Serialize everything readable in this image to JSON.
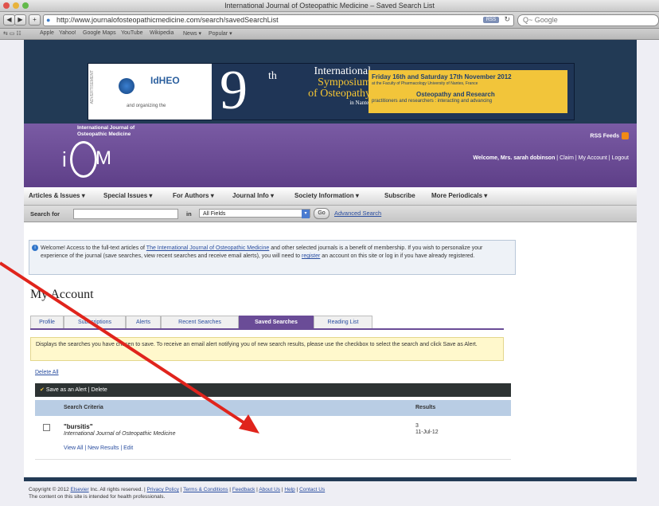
{
  "browser": {
    "window_title": "International Journal of Osteopathic Medicine – Saved Search List",
    "url": "http://www.journalofosteopathicmedicine.com/search/savedSearchList",
    "search_placeholder": "Q~ Google",
    "rss_label": "RSS",
    "bookmarks": [
      "Apple",
      "Yahoo!",
      "Google Maps",
      "YouTube",
      "Wikipedia",
      "News ▾",
      "Popular ▾"
    ]
  },
  "banner": {
    "advert_label": "ADVERTISEMENT",
    "brand": "IdHEO",
    "organizer": "and organizing the",
    "number": "9",
    "ordinal": "th",
    "symposium": [
      "International",
      "Symposium",
      "of Osteopathy",
      "in Nantes"
    ],
    "dates": "Friday 16th and Saturday 17th November 2012",
    "venue": "at the Faculty of Pharmacology University of Nantes, France",
    "theme": "Osteopathy and Research",
    "tagline": "practitioners and researchers : interacting and advancing"
  },
  "header": {
    "journal_name_l1": "International Journal of",
    "journal_name_l2": "Osteopathic Medicine",
    "logo_letters": {
      "i": "i",
      "m": "M"
    },
    "rss_feeds": "RSS Feeds",
    "welcome": "Welcome, Mrs. sarah dobinson",
    "claim": "Claim",
    "my_account": "My Account",
    "logout": "Logout"
  },
  "nav": [
    "Articles & Issues ▾",
    "Special Issues ▾",
    "For Authors ▾",
    "Journal Info ▾",
    "Society Information ▾",
    "Subscribe",
    "More Periodicals ▾"
  ],
  "search": {
    "label": "Search for",
    "in_label": "in",
    "field": "All Fields",
    "go": "Go",
    "advanced": "Advanced Search"
  },
  "notice": {
    "part1": "Welcome! Access to the full-text articles of ",
    "journal_link": "The International Journal of Osteopathic Medicine",
    "part2": " and other selected journals is a benefit of membership. If you wish to personalize your experience of the journal (save searches, view recent searches and receive email alerts), you will need to ",
    "register": "register",
    "part3": " an account on this site or log in if you have already registered."
  },
  "page_title": "My Account",
  "tabs": [
    "Profile",
    "Subscriptions",
    "Alerts",
    "Recent Searches",
    "Saved Searches",
    "Reading List"
  ],
  "active_tab": "Saved Searches",
  "info_text": "Displays the searches you have chosen to save. To receive an email alert notifying you of new search results, please use the checkbox to select the search and click Save as Alert.",
  "delete_all": "Delete All",
  "action_bar": {
    "save_alert": "Save as an Alert",
    "separator": "|",
    "delete": "Delete"
  },
  "table": {
    "headers": [
      "Search Criteria",
      "Results"
    ],
    "rows": [
      {
        "term": "\"bursitis\"",
        "journal": "International Journal of Osteopathic Medicine",
        "results": "3",
        "date": "11-Jul-12",
        "links": [
          "View All",
          "New Results",
          "Edit"
        ]
      }
    ]
  },
  "footer": {
    "copyright": "Copyright © 2012 ",
    "elsevier": "Elsevier",
    "rights": " Inc. All rights reserved. | ",
    "links": [
      "Privacy Policy",
      "Terms & Conditions",
      "Feedback",
      "About Us",
      "Help",
      "Contact Us"
    ],
    "disclaimer": "The content on this site is intended for health professionals."
  },
  "colors": {
    "header_purple": "#6a4c97",
    "banner_navy": "#1f3556",
    "annotation_arrow": "#e0241c",
    "link_blue": "#2a4ea0"
  }
}
